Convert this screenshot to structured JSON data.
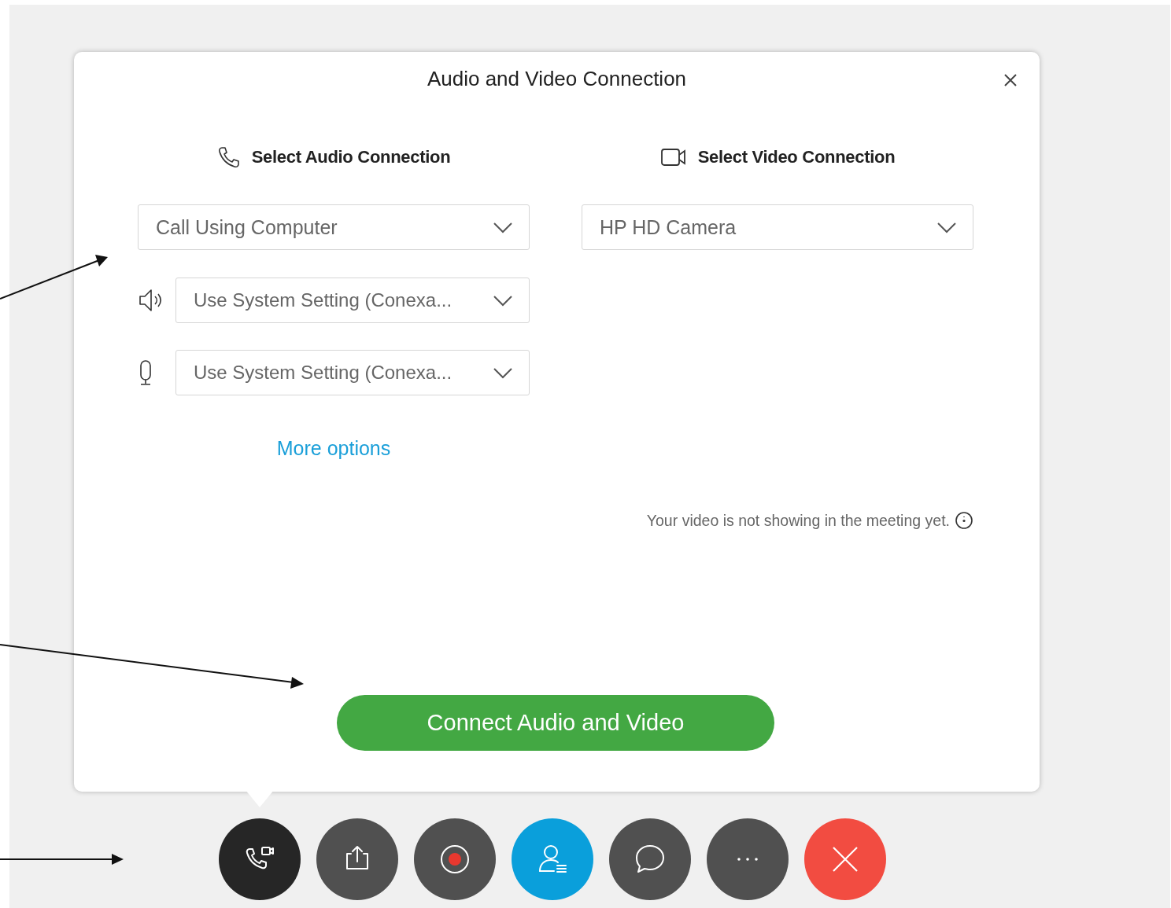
{
  "dialog": {
    "title": "Audio and Video Connection",
    "audio": {
      "heading": "Select Audio Connection",
      "connection": "Call Using Computer",
      "devices": [
        {
          "kind": "speaker",
          "value": "Use System Setting (Conexa..."
        },
        {
          "kind": "microphone",
          "value": "Use System Setting (Conexa..."
        }
      ],
      "more_options": "More options"
    },
    "video": {
      "heading": "Select Video Connection",
      "camera": "HP HD Camera",
      "note": "Your video is not showing in the meeting yet."
    },
    "connect_button": "Connect Audio and Video"
  },
  "toolbar": [
    {
      "kind": "audio-video",
      "selected": true
    },
    {
      "kind": "share",
      "selected": false
    },
    {
      "kind": "record",
      "selected": false
    },
    {
      "kind": "participants",
      "selected": false
    },
    {
      "kind": "chat",
      "selected": false
    },
    {
      "kind": "more",
      "selected": false
    },
    {
      "kind": "end",
      "selected": false
    }
  ]
}
